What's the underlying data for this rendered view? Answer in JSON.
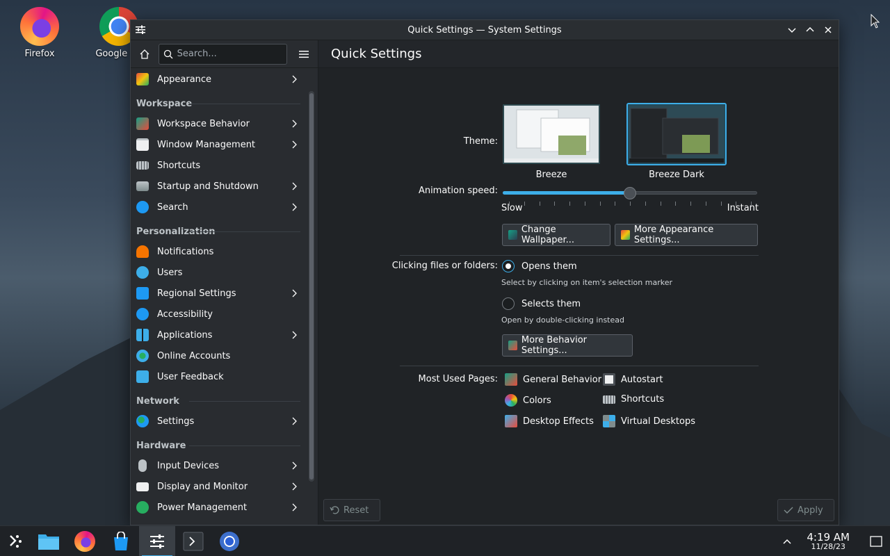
{
  "desktop": {
    "icons": [
      {
        "label": "Firefox"
      },
      {
        "label": "Google Ch"
      }
    ]
  },
  "window": {
    "title": "Quick Settings — System Settings",
    "controls": {
      "minimize": "chevron-down-icon",
      "maximize": "chevron-up-icon",
      "close": "close-icon"
    }
  },
  "sidebar": {
    "search_placeholder": "Search...",
    "top_item": {
      "label": "Appearance"
    },
    "sections": [
      {
        "title": "Workspace",
        "items": [
          {
            "label": "Workspace Behavior",
            "arrow": true
          },
          {
            "label": "Window Management",
            "arrow": true
          },
          {
            "label": "Shortcuts",
            "arrow": false
          },
          {
            "label": "Startup and Shutdown",
            "arrow": true
          },
          {
            "label": "Search",
            "arrow": true
          }
        ]
      },
      {
        "title": "Personalization",
        "items": [
          {
            "label": "Notifications",
            "arrow": false
          },
          {
            "label": "Users",
            "arrow": false
          },
          {
            "label": "Regional Settings",
            "arrow": true
          },
          {
            "label": "Accessibility",
            "arrow": false
          },
          {
            "label": "Applications",
            "arrow": true
          },
          {
            "label": "Online Accounts",
            "arrow": false
          },
          {
            "label": "User Feedback",
            "arrow": false
          }
        ]
      },
      {
        "title": "Network",
        "items": [
          {
            "label": "Settings",
            "arrow": true
          }
        ]
      },
      {
        "title": "Hardware",
        "items": [
          {
            "label": "Input Devices",
            "arrow": true
          },
          {
            "label": "Display and Monitor",
            "arrow": true
          },
          {
            "label": "Power Management",
            "arrow": true
          }
        ]
      }
    ]
  },
  "main": {
    "title": "Quick Settings",
    "theme": {
      "label": "Theme:",
      "options": [
        {
          "name": "Breeze",
          "selected": false
        },
        {
          "name": "Breeze Dark",
          "selected": true
        }
      ]
    },
    "animation": {
      "label": "Animation speed:",
      "min_label": "Slow",
      "max_label": "Instant",
      "value_fraction": 0.5
    },
    "buttons": {
      "change_wallpaper": "Change Wallpaper...",
      "more_appearance": "More Appearance Settings...",
      "more_behavior": "More Behavior Settings...",
      "reset": "Reset",
      "apply": "Apply"
    },
    "clicking": {
      "label": "Clicking files or folders:",
      "options": [
        {
          "label": "Opens them",
          "hint": "Select by clicking on item's selection marker",
          "checked": true
        },
        {
          "label": "Selects them",
          "hint": "Open by double-clicking instead",
          "checked": false
        }
      ]
    },
    "most_used": {
      "label": "Most Used Pages:",
      "links": [
        {
          "label": "General Behavior"
        },
        {
          "label": "Autostart"
        },
        {
          "label": "Colors"
        },
        {
          "label": "Shortcuts"
        },
        {
          "label": "Desktop Effects"
        },
        {
          "label": "Virtual Desktops"
        }
      ]
    }
  },
  "taskbar": {
    "time": "4:19 AM",
    "date": "11/28/23"
  },
  "colors": {
    "accent": "#3daee9",
    "window_bg": "#202326",
    "sidebar_bg": "#292c30"
  }
}
